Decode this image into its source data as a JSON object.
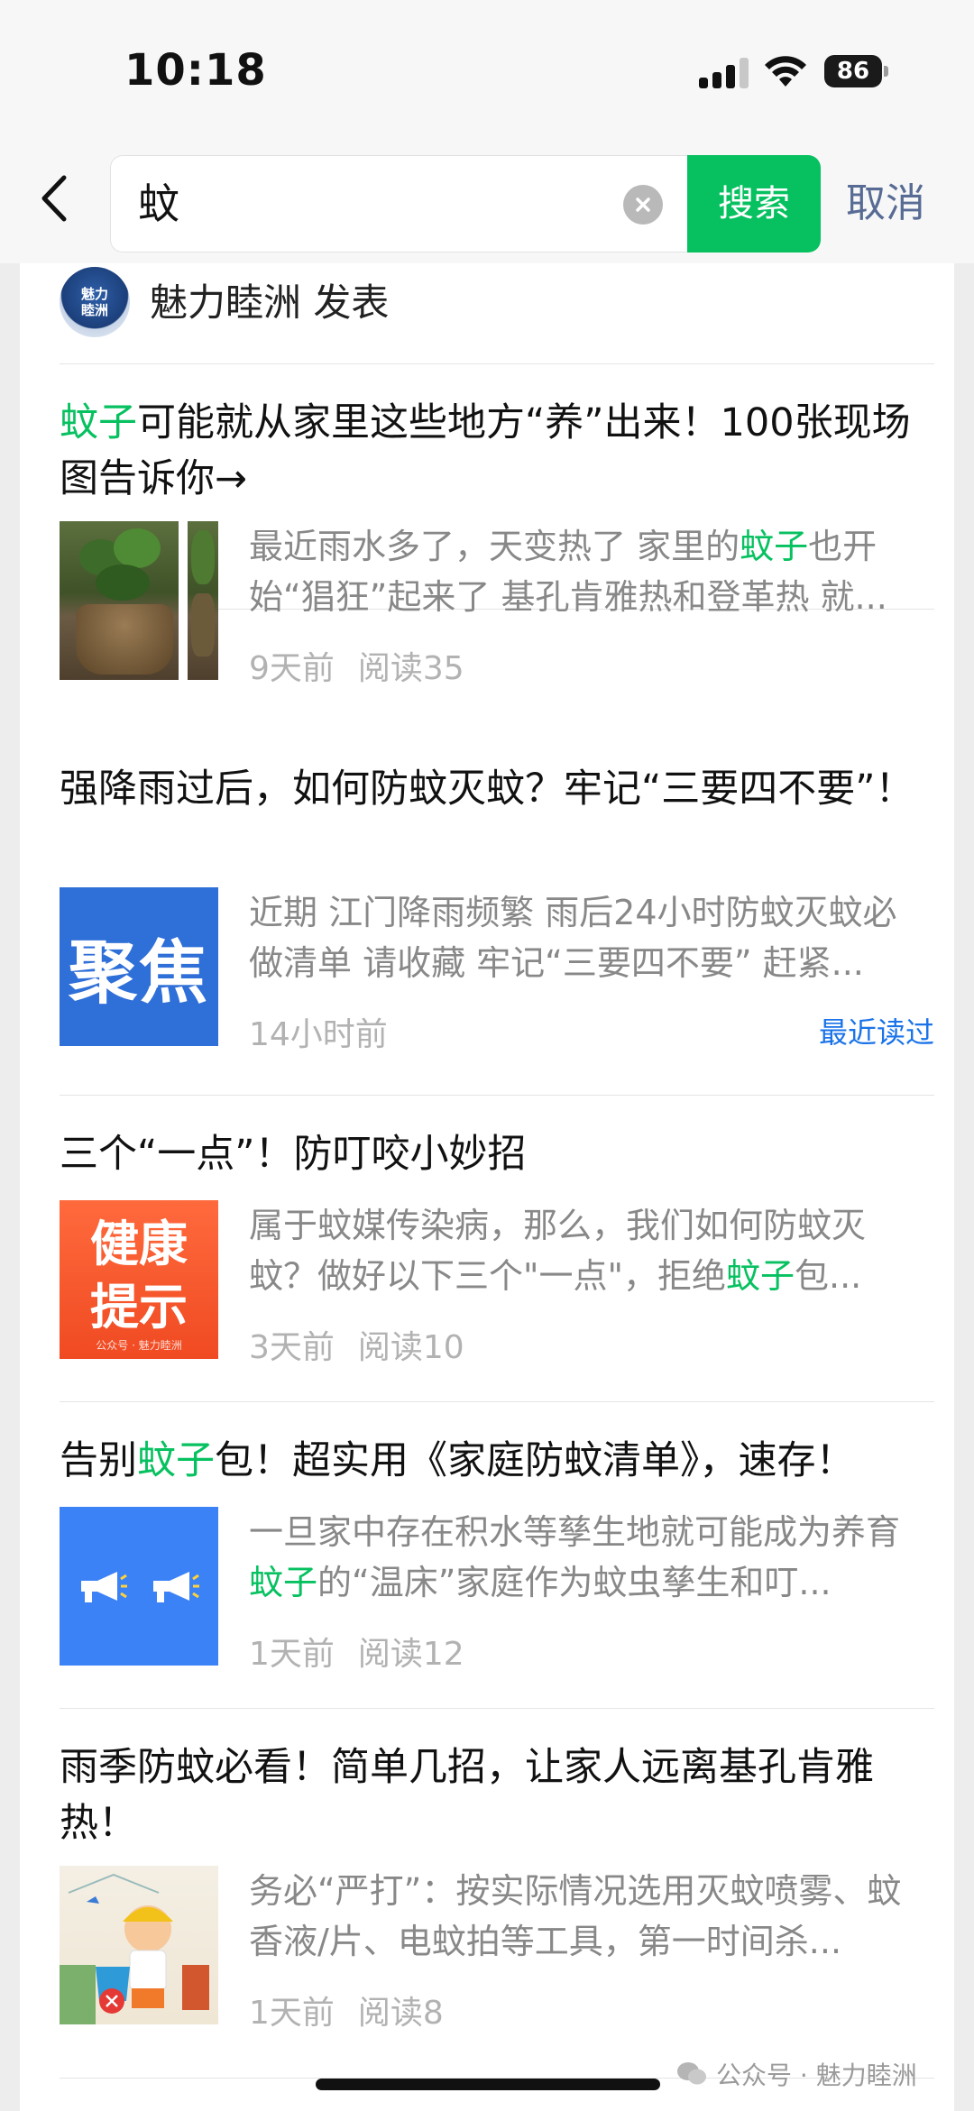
{
  "status_bar": {
    "time": "10:18",
    "battery": "86"
  },
  "search": {
    "query": "蚊",
    "search_label": "搜索",
    "cancel_label": "取消"
  },
  "author": {
    "avatar_text_1": "魅力",
    "avatar_text_2": "睦洲",
    "line": "魅力睦洲 发表"
  },
  "articles": [
    {
      "title_hl": "蚊子",
      "title_rest": "可能就从家里这些地方“养”出来！100张现场图告诉你→",
      "summary_pre": "最近雨水多了，天变热了 家里的",
      "summary_hl": "蚊子",
      "summary_post": "也开始“猖狂”起来了 基孔肯雅热和登革热 就...",
      "time": "9天前",
      "reads": "阅读35"
    },
    {
      "title": "强降雨过后，如何防蚊灭蚊？牢记“三要四不要”！",
      "thumb_text": "聚焦",
      "summary": "近期 江门降雨频繁 雨后24小时防蚊灭蚊必做清单 请收藏 牢记“三要四不要” 赶紧...",
      "time": "14小时前",
      "recent": "最近读过"
    },
    {
      "title": "三个“一点”！防叮咬小妙招",
      "thumb_line1": "健康",
      "thumb_line2": "提示",
      "thumb_small": "公众号 · 魅力睦洲",
      "summary_pre": "属于蚊媒传染病，那么，我们如何防蚊灭蚊？做好以下三个\"一点\"，拒绝",
      "summary_hl": "蚊子",
      "summary_post": "包...",
      "time": "3天前",
      "reads": "阅读10"
    },
    {
      "title_pre": "告别",
      "title_hl": "蚊子",
      "title_post": "包！超实用《家庭防蚊清单》，速存！",
      "summary_pre": "一旦家中存在积水等孳生地就可能成为养育",
      "summary_hl": "蚊子",
      "summary_post": "的“温床”家庭作为蚊虫孳生和叮...",
      "time": "1天前",
      "reads": "阅读12"
    },
    {
      "title": "雨季防蚊必看！简单几招，让家人远离基孔肯雅热！",
      "summary": "务必“严打”：按实际情况选用灭蚊喷雾、蚊香液/片、电蚊拍等工具，第一时间杀...",
      "time": "1天前",
      "reads": "阅读8"
    }
  ],
  "watermark": "公众号 · 魅力睦洲",
  "colors": {
    "accent_green": "#07c160",
    "link_blue": "#576b95",
    "recent_blue": "#1a73e8"
  }
}
